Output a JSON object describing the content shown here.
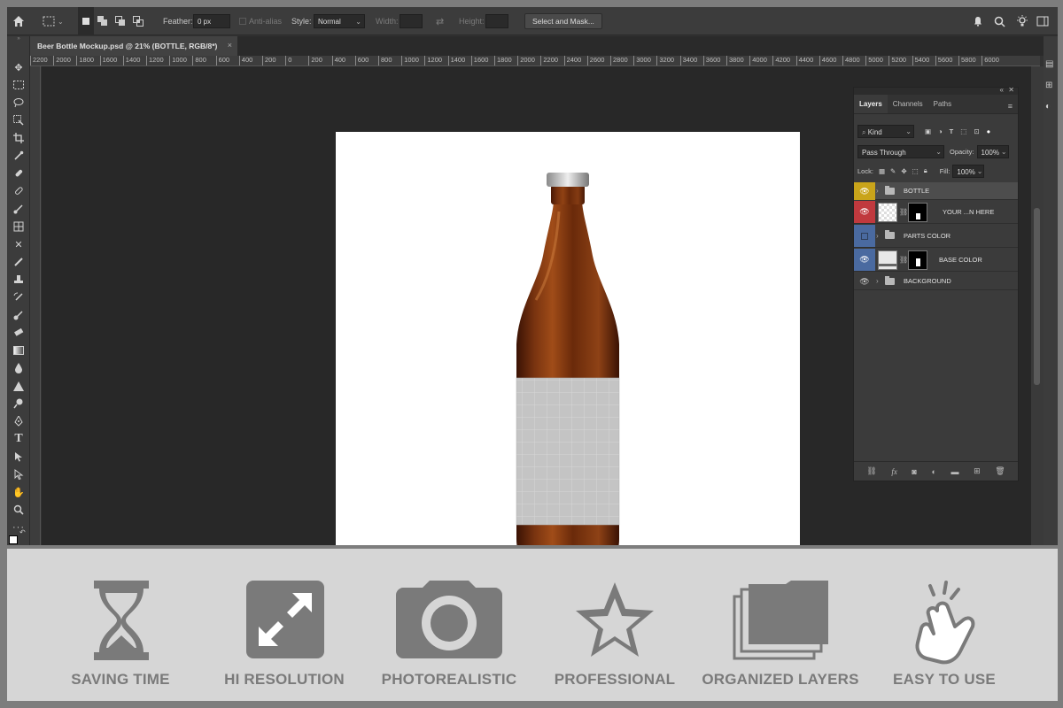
{
  "options_bar": {
    "feather_label": "Feather:",
    "feather_value": "0 px",
    "antialias_label": "Anti-alias",
    "style_label": "Style:",
    "style_value": "Normal",
    "width_label": "Width:",
    "height_label": "Height:",
    "select_mask_label": "Select and Mask..."
  },
  "document_tab": {
    "title": "Beer Bottle Mockup.psd @ 21% (BOTTLE, RGB/8*)",
    "close": "×"
  },
  "ruler_ticks": [
    "2200",
    "2000",
    "1800",
    "1600",
    "1400",
    "1200",
    "1000",
    "800",
    "600",
    "400",
    "200",
    "0",
    "200",
    "400",
    "600",
    "800",
    "1000",
    "1200",
    "1400",
    "1600",
    "1800",
    "2000",
    "2200",
    "2400",
    "2600",
    "2800",
    "3000",
    "3200",
    "3400",
    "3600",
    "3800",
    "4000",
    "4200",
    "4400",
    "4600",
    "4800",
    "5000",
    "5200",
    "5400",
    "5600",
    "5800",
    "6000"
  ],
  "layers_panel": {
    "tabs": [
      "Layers",
      "Channels",
      "Paths"
    ],
    "kind_label": "Kind",
    "blend_mode": "Pass Through",
    "opacity_label": "Opacity:",
    "opacity_value": "100%",
    "lock_label": "Lock:",
    "fill_label": "Fill:",
    "fill_value": "100%",
    "layers": [
      {
        "name": "BOTTLE",
        "eye_color": "#c9a41a",
        "type": "group",
        "visible": true
      },
      {
        "name": "YOUR ...N HERE",
        "eye_color": "#c0393e",
        "type": "smart",
        "visible": true
      },
      {
        "name": "PARTS COLOR",
        "eye_color": "#4a6aa0",
        "type": "group",
        "visible": false
      },
      {
        "name": "BASE COLOR",
        "eye_color": "#4a6aa0",
        "type": "fill",
        "visible": true
      },
      {
        "name": "BACKGROUND",
        "eye_color": "",
        "type": "group",
        "visible": true
      }
    ]
  },
  "features": [
    {
      "label": "SAVING TIME",
      "icon": "hourglass-icon"
    },
    {
      "label": "HI RESOLUTION",
      "icon": "expand-arrows-icon"
    },
    {
      "label": "PHOTOREALISTIC",
      "icon": "camera-icon"
    },
    {
      "label": "PROFESSIONAL",
      "icon": "star-icon"
    },
    {
      "label": "ORGANIZED LAYERS",
      "icon": "stacked-folders-icon"
    },
    {
      "label": "EASY TO USE",
      "icon": "tap-hand-icon"
    }
  ],
  "colors": {
    "feature_icon": "#7a7a7a",
    "bottle_amber": "#6b2a0c",
    "label_gray": "#c8c8c8"
  }
}
